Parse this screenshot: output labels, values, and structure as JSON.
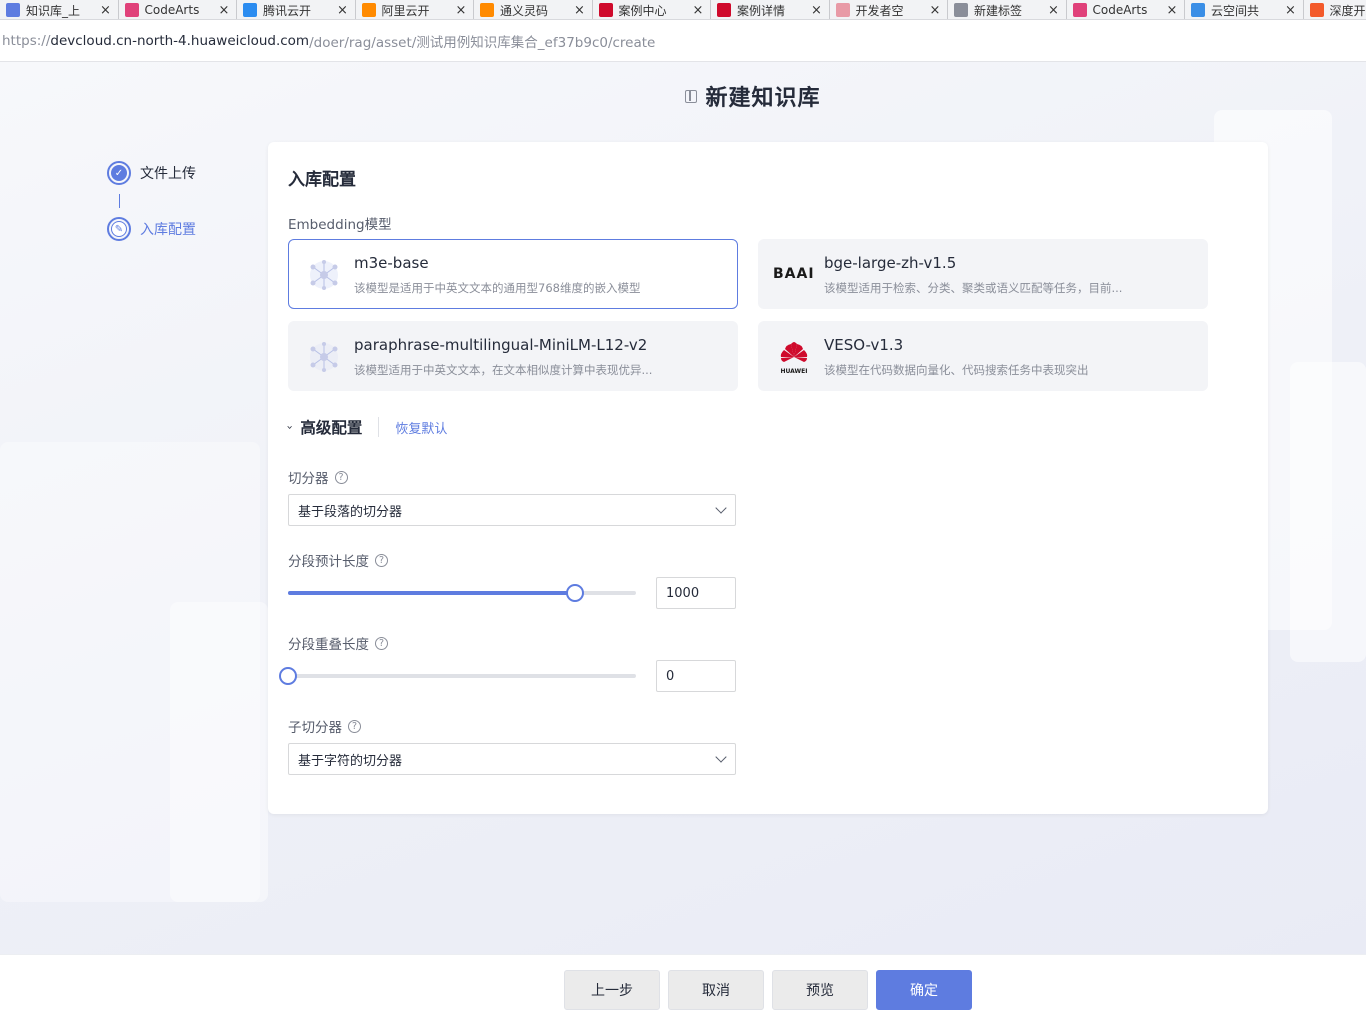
{
  "browser": {
    "tabs": [
      {
        "label": "知识库_上",
        "icon": "doc-icon",
        "color": "#5e7ce0"
      },
      {
        "label": "CodeArts",
        "icon": "codearts-icon",
        "color": "#e0417a"
      },
      {
        "label": "腾讯云开",
        "icon": "cloud-icon",
        "color": "#2b8cf0"
      },
      {
        "label": "阿里云开",
        "icon": "bracket-icon",
        "color": "#ff8a00"
      },
      {
        "label": "通义灵码",
        "icon": "bracket-icon",
        "color": "#ff8a00"
      },
      {
        "label": "案例中心",
        "icon": "huawei-icon",
        "color": "#cf0a2c"
      },
      {
        "label": "案例详情",
        "icon": "huawei-icon",
        "color": "#cf0a2c"
      },
      {
        "label": "开发者空",
        "icon": "huawei-icon",
        "color": "#e89aa6"
      },
      {
        "label": "新建标签",
        "icon": "calendar-icon",
        "color": "#8a8e99"
      },
      {
        "label": "CodeArts",
        "icon": "codearts-icon",
        "color": "#e0417a"
      },
      {
        "label": "云空间共",
        "icon": "cube-icon",
        "color": "#3a8ee6"
      },
      {
        "label": "深度开发",
        "icon": "orange-icon",
        "color": "#f35a2b"
      }
    ],
    "url_prefix": "https://",
    "url_host": "devcloud.cn-north-4.huaweicloud.com",
    "url_path": "/doer/rag/asset/测试用例知识库集合_ef37b9c0/create"
  },
  "page": {
    "title": "新建知识库"
  },
  "steps": [
    {
      "label": "文件上传",
      "state": "done"
    },
    {
      "label": "入库配置",
      "state": "active"
    }
  ],
  "card": {
    "title": "入库配置",
    "embedding_label": "Embedding模型",
    "models": [
      {
        "name": "m3e-base",
        "desc": "该模型是适用于中英文文本的通用型768维度的嵌入模型",
        "logo": "network-icon",
        "selected": true
      },
      {
        "name": "bge-large-zh-v1.5",
        "desc": "该模型适用于检索、分类、聚类或语义匹配等任务，目前...",
        "logo": "BAAI",
        "selected": false
      },
      {
        "name": "paraphrase-multilingual-MiniLM-L12-v2",
        "desc": "该模型适用于中英文文本，在文本相似度计算中表现优异...",
        "logo": "network-icon",
        "selected": false
      },
      {
        "name": "VESO-v1.3",
        "desc": "该模型在代码数据向量化、代码搜索任务中表现突出",
        "logo": "HUAWEI",
        "selected": false
      }
    ],
    "advanced": {
      "title": "高级配置",
      "reset": "恢复默认"
    },
    "splitter": {
      "label": "切分器",
      "value": "基于段落的切分器"
    },
    "chunk_len": {
      "label": "分段预计长度",
      "value": "1000",
      "fraction": 0.825
    },
    "overlap_len": {
      "label": "分段重叠长度",
      "value": "0",
      "fraction": 0
    },
    "sub_splitter": {
      "label": "子切分器",
      "value": "基于字符的切分器"
    }
  },
  "footer": {
    "prev": "上一步",
    "cancel": "取消",
    "preview": "预览",
    "confirm": "确定"
  },
  "colors": {
    "accent": "#5e7ce0"
  }
}
